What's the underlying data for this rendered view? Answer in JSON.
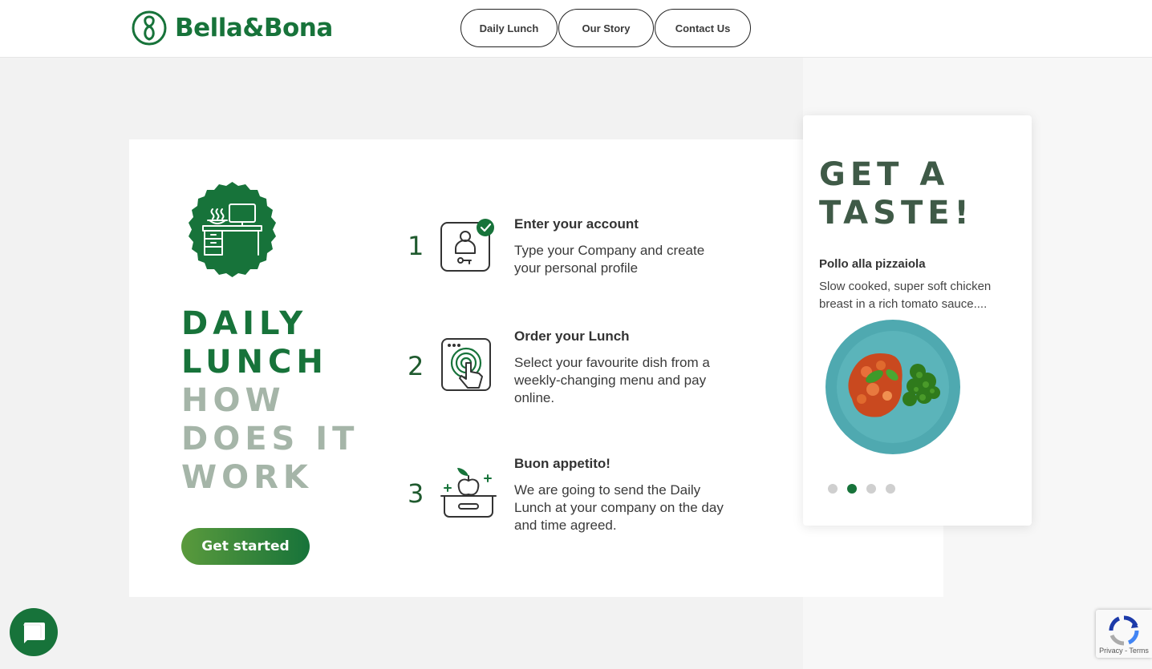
{
  "header": {
    "brand": "Bella&Bona",
    "nav": [
      {
        "label": "Daily Lunch"
      },
      {
        "label": "Our Story"
      },
      {
        "label": "Contact Us"
      }
    ]
  },
  "main": {
    "title_line1": "DAILY",
    "title_line2": "LUNCH",
    "subtitle_line1": "HOW",
    "subtitle_line2": "DOES IT",
    "subtitle_line3": "WORK",
    "cta_label": "Get started",
    "steps": [
      {
        "number": "1",
        "icon": "user-check-icon",
        "title": "Enter your account",
        "desc": "Type your Company and create your personal profile"
      },
      {
        "number": "2",
        "icon": "tap-screen-icon",
        "title": "Order your Lunch",
        "desc": "Select your favourite dish from a weekly-changing menu and pay online."
      },
      {
        "number": "3",
        "icon": "lunchbox-apple-icon",
        "title": "Buon appetito!",
        "desc": "We are going to send the Daily Lunch at your company on the day and time agreed."
      }
    ]
  },
  "carousel": {
    "title_line1": "GET A",
    "title_line2": "TASTE!",
    "dish_name": "Pollo alla pizzaiola",
    "dish_desc": "Slow cooked, super soft chicken breast in a rich tomato sauce....",
    "dots": 4,
    "active_dot": 1
  },
  "recaptcha": {
    "text": "Privacy - Terms"
  },
  "colors": {
    "brand_green": "#17733a",
    "muted_green": "#a5b5a8",
    "carousel_title": "#3f5a47"
  }
}
